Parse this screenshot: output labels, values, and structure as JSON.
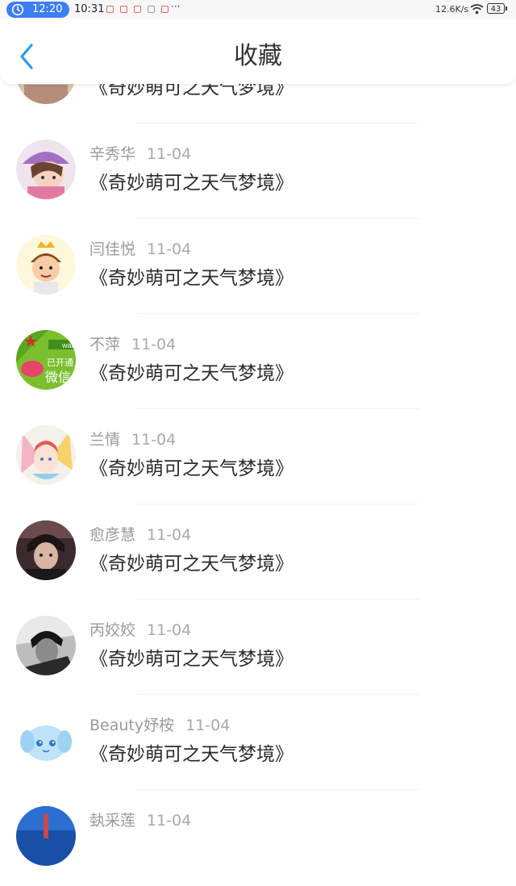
{
  "status_bar": {
    "timer": "12:20",
    "time": "10:31",
    "more": "···",
    "network_speed": "12.6K/s",
    "battery": "43"
  },
  "header": {
    "title": "收藏",
    "back_icon": "chevron-left-icon"
  },
  "favorites": [
    {
      "user": "",
      "date": "",
      "title": "《奇妙萌可之天气梦境》"
    },
    {
      "user": "辛秀华",
      "date": "11-04",
      "title": "《奇妙萌可之天气梦境》"
    },
    {
      "user": "闫佳悦",
      "date": "11-04",
      "title": "《奇妙萌可之天气梦境》"
    },
    {
      "user": "不萍",
      "date": "11-04",
      "title": "《奇妙萌可之天气梦境》",
      "avatar_text_1": "已开通",
      "avatar_text_2": "微信",
      "avatar_text_3": "wat"
    },
    {
      "user": "兰情",
      "date": "11-04",
      "title": "《奇妙萌可之天气梦境》"
    },
    {
      "user": "愈彦慧",
      "date": "11-04",
      "title": "《奇妙萌可之天气梦境》"
    },
    {
      "user": "丙姣姣",
      "date": "11-04",
      "title": "《奇妙萌可之天气梦境》"
    },
    {
      "user": "Beauty妤桉",
      "date": "11-04",
      "title": "《奇妙萌可之天气梦境》"
    },
    {
      "user": "埶采莲",
      "date": "11-04",
      "title": ""
    }
  ],
  "colors": {
    "accent": "#3e7ef3",
    "back_arrow": "#2f9be9"
  }
}
